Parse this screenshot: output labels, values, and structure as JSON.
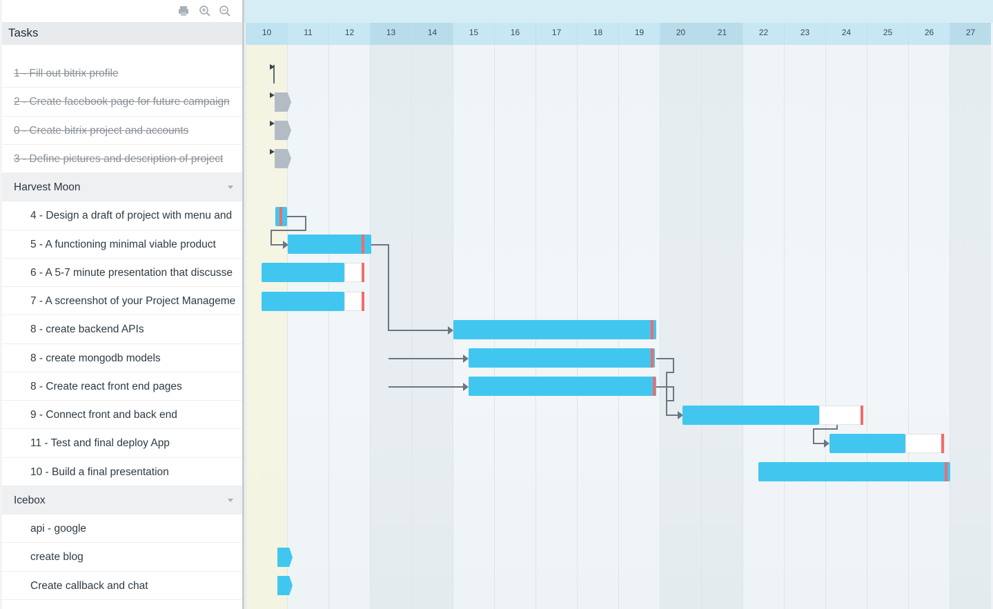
{
  "toolbar": {
    "print_icon": "print-icon",
    "zoom_in_icon": "zoom-in-icon",
    "zoom_out_icon": "zoom-out-icon"
  },
  "tasks_header": "Tasks",
  "rows": [
    {
      "label": "1 - Fill out bitrix profile",
      "type": "task",
      "done": true
    },
    {
      "label": "2 - Create facebook page for future campaign",
      "type": "task",
      "done": true
    },
    {
      "label": "0 - Create bitrix project and accounts",
      "type": "task",
      "done": true
    },
    {
      "label": "3 - Define pictures and description of project",
      "type": "task",
      "done": true
    },
    {
      "label": "Harvest Moon",
      "type": "group"
    },
    {
      "label": "4 - Design a draft of project with menu and",
      "type": "subtask"
    },
    {
      "label": "5 - A functioning minimal viable product",
      "type": "subtask"
    },
    {
      "label": "6 - A 5-7 minute presentation that discusse",
      "type": "subtask"
    },
    {
      "label": "7 - A screenshot of your Project Manageme",
      "type": "subtask"
    },
    {
      "label": "8 - create backend APIs",
      "type": "subtask"
    },
    {
      "label": "8 - create mongodb models",
      "type": "subtask"
    },
    {
      "label": "8 - Create react front end pages",
      "type": "subtask"
    },
    {
      "label": "9 - Connect front and back end",
      "type": "subtask"
    },
    {
      "label": "11 - Test and final deploy App",
      "type": "subtask"
    },
    {
      "label": "10 - Build a final presentation",
      "type": "subtask"
    },
    {
      "label": "Icebox",
      "type": "group"
    },
    {
      "label": "api - google",
      "type": "subtask"
    },
    {
      "label": "create blog",
      "type": "subtask"
    },
    {
      "label": "Create callback and chat",
      "type": "subtask"
    }
  ],
  "timeline": {
    "days": [
      "10",
      "11",
      "12",
      "13",
      "14",
      "15",
      "16",
      "17",
      "18",
      "19",
      "20",
      "21",
      "22",
      "23",
      "24",
      "25",
      "26",
      "27"
    ],
    "weekend_days": [
      "13",
      "14",
      "20",
      "21",
      "27"
    ],
    "today": "10"
  },
  "colors": {
    "bar": "#41c7ef",
    "deadline": "#f26b6b",
    "completed_bar": "#b3bcc5",
    "connector": "#6b7680"
  }
}
